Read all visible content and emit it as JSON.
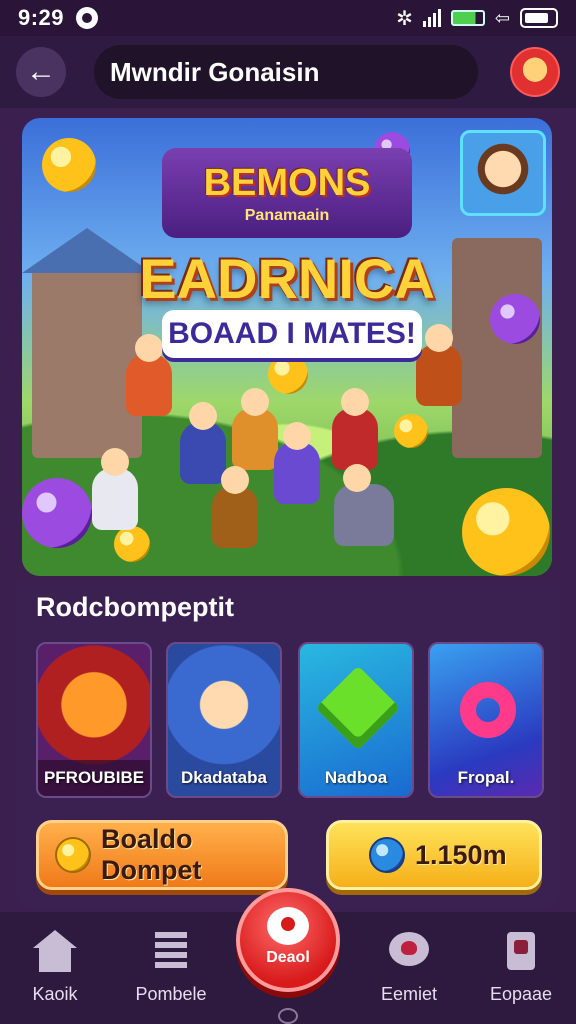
{
  "status_bar": {
    "time": "9:29",
    "bluetooth_glyph": "✲",
    "arrow_glyph": "⇦"
  },
  "header": {
    "back_glyph": "←",
    "title": "Mwndir Gonaisin"
  },
  "banner": {
    "logo_title": "BEMONS",
    "logo_subtitle": "Panamaain",
    "title": "EADRNICA",
    "subtitle": "BOAAD I MATES!"
  },
  "recommended": {
    "title": "Rodcbompeptit",
    "cards": [
      {
        "label": "PFROUBIBE"
      },
      {
        "label": "Dkadataba"
      },
      {
        "label": "Nadboa"
      },
      {
        "label": "Fropal."
      }
    ]
  },
  "actions": {
    "primary_label": "Boaldo Dompet",
    "secondary_value": "1.150m"
  },
  "bottom_nav": {
    "items": [
      {
        "label": "Kaoik",
        "icon": "home-icon"
      },
      {
        "label": "Pombele",
        "icon": "list-icon"
      },
      {
        "label": "Eemiet",
        "icon": "chat-icon"
      },
      {
        "label": "Eopaae",
        "icon": "card-icon"
      }
    ],
    "center_label": "Deaol"
  },
  "colors": {
    "background": "#3a1f4f",
    "header": "#2f1a42",
    "accent_orange": "#f07a1a",
    "accent_yellow": "#f5b01a",
    "accent_red": "#d81a1a"
  }
}
